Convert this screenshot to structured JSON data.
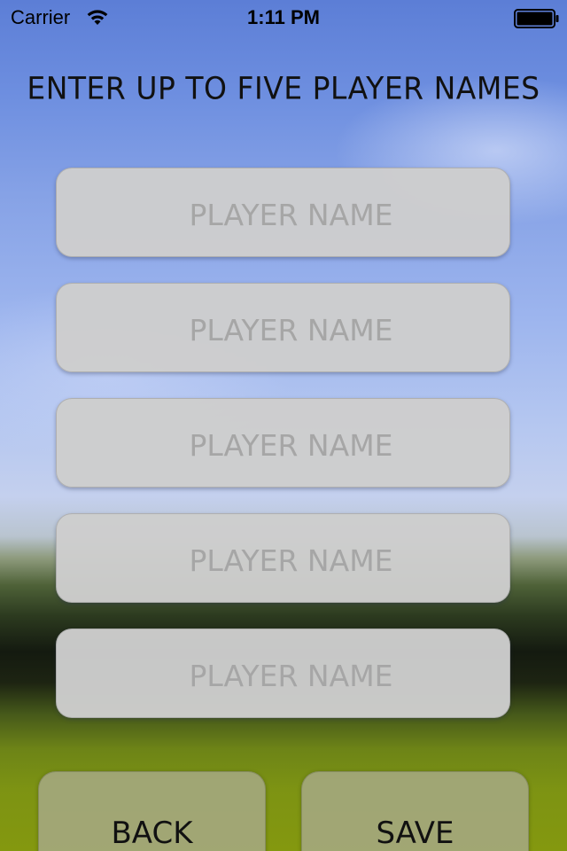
{
  "status_bar": {
    "carrier": "Carrier",
    "time": "1:11 PM",
    "wifi_icon": "wifi-icon",
    "battery_icon": "battery-full-icon"
  },
  "header": {
    "title": "ENTER UP TO FIVE PLAYER NAMES"
  },
  "form": {
    "fields": [
      {
        "placeholder": "PLAYER NAME",
        "value": ""
      },
      {
        "placeholder": "PLAYER NAME",
        "value": ""
      },
      {
        "placeholder": "PLAYER NAME",
        "value": ""
      },
      {
        "placeholder": "PLAYER NAME",
        "value": ""
      },
      {
        "placeholder": "PLAYER NAME",
        "value": ""
      }
    ]
  },
  "buttons": {
    "back_label": "BACK",
    "save_label": "SAVE"
  },
  "colors": {
    "sky_top": "#5c7ed6",
    "sky_bottom": "#c4d0ee",
    "ground": "#7d9313",
    "field_bg": "#cdcdcd",
    "placeholder_text": "#a6a6a6",
    "button_bg": "#a5a882"
  }
}
